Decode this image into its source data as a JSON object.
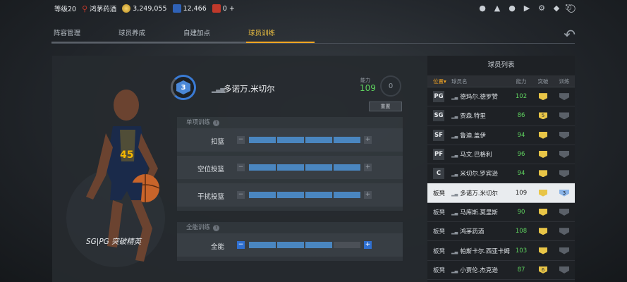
{
  "topbar": {
    "level": "等级20",
    "club": "鸿茅药酒",
    "coins": "3,249,055",
    "tickets": "12,466",
    "gems": "0",
    "plus": "+"
  },
  "tabs": [
    {
      "label": "阵容管理"
    },
    {
      "label": "球员养成"
    },
    {
      "label": "自建加点"
    },
    {
      "label": "球员训练",
      "active": true
    }
  ],
  "player": {
    "level": "3",
    "name": "多诺万.米切尔",
    "rating_label": "能力",
    "rating": "109",
    "potential": "0",
    "caption": "SG|PG 突破精英",
    "reset_label": "重置"
  },
  "single_training": {
    "title": "单项训练",
    "rows": [
      {
        "label": "扣篮",
        "filled": 4
      },
      {
        "label": "空位投篮",
        "filled": 4
      },
      {
        "label": "干扰投篮",
        "filled": 4
      }
    ]
  },
  "all_training": {
    "title": "全能训练",
    "rows": [
      {
        "label": "全能",
        "filled": 3
      }
    ]
  },
  "roster": {
    "title": "球员列表",
    "headers": {
      "pos": "位置",
      "name": "球员名",
      "rating": "能力",
      "break": "突破",
      "train": "训练"
    },
    "rows": [
      {
        "pos": "PG",
        "bench": false,
        "name": "德玛尔.德罗赞",
        "rating": "102",
        "brk": "",
        "train": ""
      },
      {
        "pos": "SG",
        "bench": false,
        "name": "贾森.特里",
        "rating": "86",
        "brk": "5",
        "train": ""
      },
      {
        "pos": "SF",
        "bench": false,
        "name": "鲁迪.盖伊",
        "rating": "94",
        "brk": "",
        "train": ""
      },
      {
        "pos": "PF",
        "bench": false,
        "name": "马文.巴格利",
        "rating": "96",
        "brk": "",
        "train": ""
      },
      {
        "pos": "C",
        "bench": false,
        "name": "米切尔.罗宾逊",
        "rating": "94",
        "brk": "",
        "train": ""
      },
      {
        "pos": "板凳",
        "bench": true,
        "name": "多诺万.米切尔",
        "rating": "109",
        "brk": "",
        "train": "3",
        "selected": true
      },
      {
        "pos": "板凳",
        "bench": true,
        "name": "马库斯.莫里斯",
        "rating": "90",
        "brk": "",
        "train": ""
      },
      {
        "pos": "板凳",
        "bench": true,
        "name": "鸿茅药酒",
        "rating": "108",
        "brk": "",
        "train": ""
      },
      {
        "pos": "板凳",
        "bench": true,
        "name": "帕斯卡尔.西亚卡姆",
        "rating": "103",
        "brk": "",
        "train": ""
      },
      {
        "pos": "板凳",
        "bench": true,
        "name": "小贾伦.杰克逊",
        "rating": "87",
        "brk": "6",
        "train": ""
      }
    ]
  },
  "colors": {
    "accent": "#f5a623",
    "bar": "#4a86c0",
    "rating_green": "#5fd35f"
  }
}
